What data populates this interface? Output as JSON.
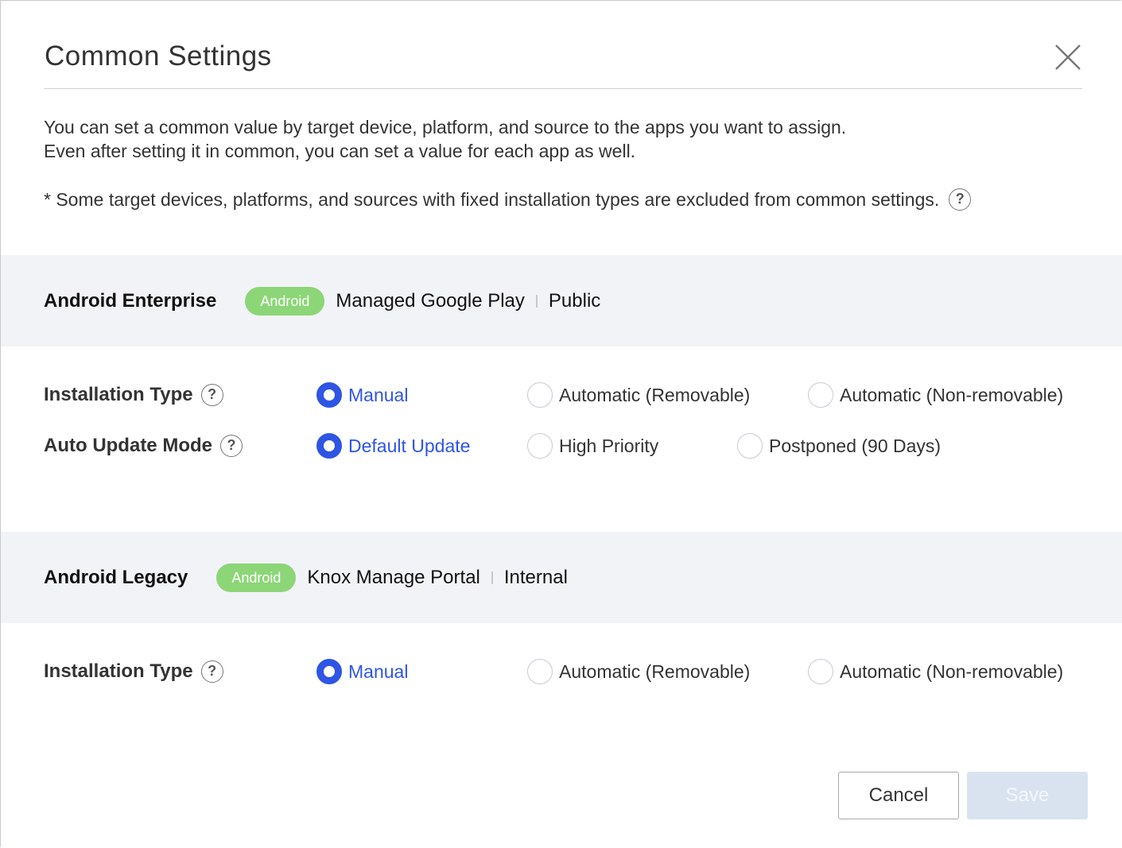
{
  "dialog": {
    "title": "Common Settings",
    "close_icon": "close-icon",
    "description_line1": "You can set a common value by target device, platform, and source to the apps you want to assign.",
    "description_line2": "Even after setting it in common, you can set a value for each app as well.",
    "note": "* Some target devices, platforms, and sources with fixed installation types are excluded from common settings.",
    "help_glyph": "?"
  },
  "sections": [
    {
      "title": "Android Enterprise",
      "badge": "Android",
      "source": "Managed Google Play",
      "type": "Public",
      "settings": [
        {
          "label": "Installation Type",
          "options": [
            "Manual",
            "Automatic (Removable)",
            "Automatic (Non-removable)"
          ],
          "selected": "Manual"
        },
        {
          "label": "Auto Update Mode",
          "options": [
            "Default Update",
            "High Priority",
            "Postponed (90 Days)"
          ],
          "selected": "Default Update"
        }
      ]
    },
    {
      "title": "Android Legacy",
      "badge": "Android",
      "source": "Knox Manage Portal",
      "type": "Internal",
      "settings": [
        {
          "label": "Installation Type",
          "options": [
            "Manual",
            "Automatic (Removable)",
            "Automatic (Non-removable)"
          ],
          "selected": "Manual"
        }
      ]
    }
  ],
  "footer": {
    "cancel_label": "Cancel",
    "save_label": "Save",
    "save_enabled": false
  },
  "colors": {
    "accent": "#2f55e4",
    "badge_bg": "#8cd677",
    "section_bg": "#f2f3f7",
    "save_disabled_bg": "#d9e3f0"
  }
}
